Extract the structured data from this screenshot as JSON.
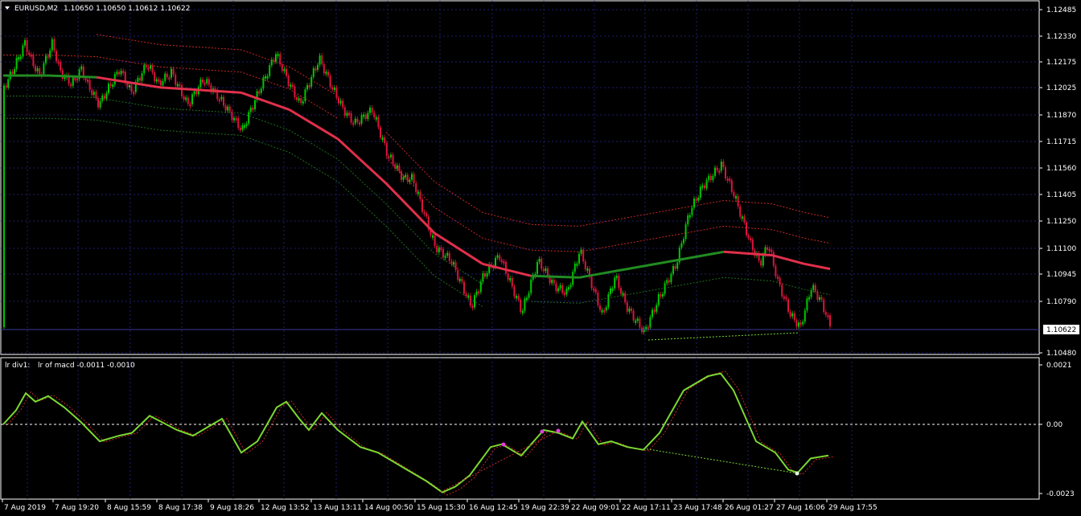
{
  "header": {
    "symbol": "EURUSD,M2",
    "ohlc": "1.10650 1.10650 1.10612 1.10622"
  },
  "indicator_header": {
    "name": "lr div1:",
    "values": "lr of macd -0.0011 -0.0010"
  },
  "price_axis": {
    "labels": [
      "1.12485",
      "1.12330",
      "1.12175",
      "1.12025",
      "1.11870",
      "1.11715",
      "1.11560",
      "1.11405",
      "1.11250",
      "1.11100",
      "1.10945",
      "1.10790",
      "1.10480"
    ],
    "current_price": "1.10622"
  },
  "indicator_axis": {
    "labels": [
      "0.0021",
      "0.00",
      "-0.0023"
    ]
  },
  "time_axis": {
    "labels": [
      "7 Aug 2019",
      "7 Aug 19:20",
      "8 Aug 15:59",
      "8 Aug 17:38",
      "9 Aug 18:26",
      "12 Aug 13:52",
      "13 Aug 13:11",
      "14 Aug 00:50",
      "15 Aug 15:30",
      "16 Aug 12:45",
      "19 Aug 22:39",
      "22 Aug 09:01",
      "22 Aug 17:11",
      "23 Aug 17:48",
      "26 Aug 01:27",
      "27 Aug 16:06",
      "29 Aug 17:55"
    ]
  },
  "colors": {
    "background": "#000000",
    "bull": "#00c800",
    "bear": "#dc143c",
    "ma_up": "#228b22",
    "ma_down": "#e0304a",
    "band_upper": "#c82828",
    "band_lower": "#1e6e1e",
    "grid": "#1e1e6e",
    "indicator_line": "#7cd832",
    "signal_line": "#c82828",
    "text": "#ffffff"
  },
  "chart_data": {
    "type": "line",
    "price_series": [
      [
        "7 Aug 2019",
        1.1203
      ],
      [
        "7 Aug 19:20",
        1.1226
      ],
      [
        "8 Aug 15:59",
        1.1212
      ],
      [
        "8 Aug 17:38",
        1.1213
      ],
      [
        "9 Aug 18:26",
        1.1195
      ],
      [
        "12 Aug 13:52",
        1.1224
      ],
      [
        "13 Aug 13:11",
        1.1208
      ],
      [
        "14 Aug 00:50",
        1.1186
      ],
      [
        "15 Aug 15:30",
        1.1118
      ],
      [
        "16 Aug 12:45",
        1.1088
      ],
      [
        "19 Aug 22:39",
        1.1093
      ],
      [
        "22 Aug 09:01",
        1.1087
      ],
      [
        "22 Aug 17:11",
        1.1066
      ],
      [
        "23 Aug 17:48",
        1.1131
      ],
      [
        "26 Aug 01:27",
        1.1147
      ],
      [
        "27 Aug 16:06",
        1.1075
      ],
      [
        "29 Aug 17:55",
        1.1062
      ]
    ],
    "indicator_series": [
      [
        "7 Aug 2019",
        0.0
      ],
      [
        "7 Aug 19:20",
        0.0006
      ],
      [
        "8 Aug 15:59",
        -0.0003
      ],
      [
        "8 Aug 17:38",
        0.0001
      ],
      [
        "9 Aug 18:26",
        -0.0004
      ],
      [
        "12 Aug 13:52",
        0.0004
      ],
      [
        "13 Aug 13:11",
        0.0002
      ],
      [
        "14 Aug 00:50",
        -0.0005
      ],
      [
        "15 Aug 15:30",
        -0.0021
      ],
      [
        "16 Aug 12:45",
        -0.0006
      ],
      [
        "19 Aug 22:39",
        -0.0002
      ],
      [
        "22 Aug 09:01",
        -0.0002
      ],
      [
        "22 Aug 17:11",
        -0.0007
      ],
      [
        "23 Aug 17:48",
        0.0016
      ],
      [
        "26 Aug 01:27",
        0.0016
      ],
      [
        "27 Aug 16:06",
        -0.0013
      ],
      [
        "29 Aug 17:55",
        -0.001
      ]
    ]
  }
}
